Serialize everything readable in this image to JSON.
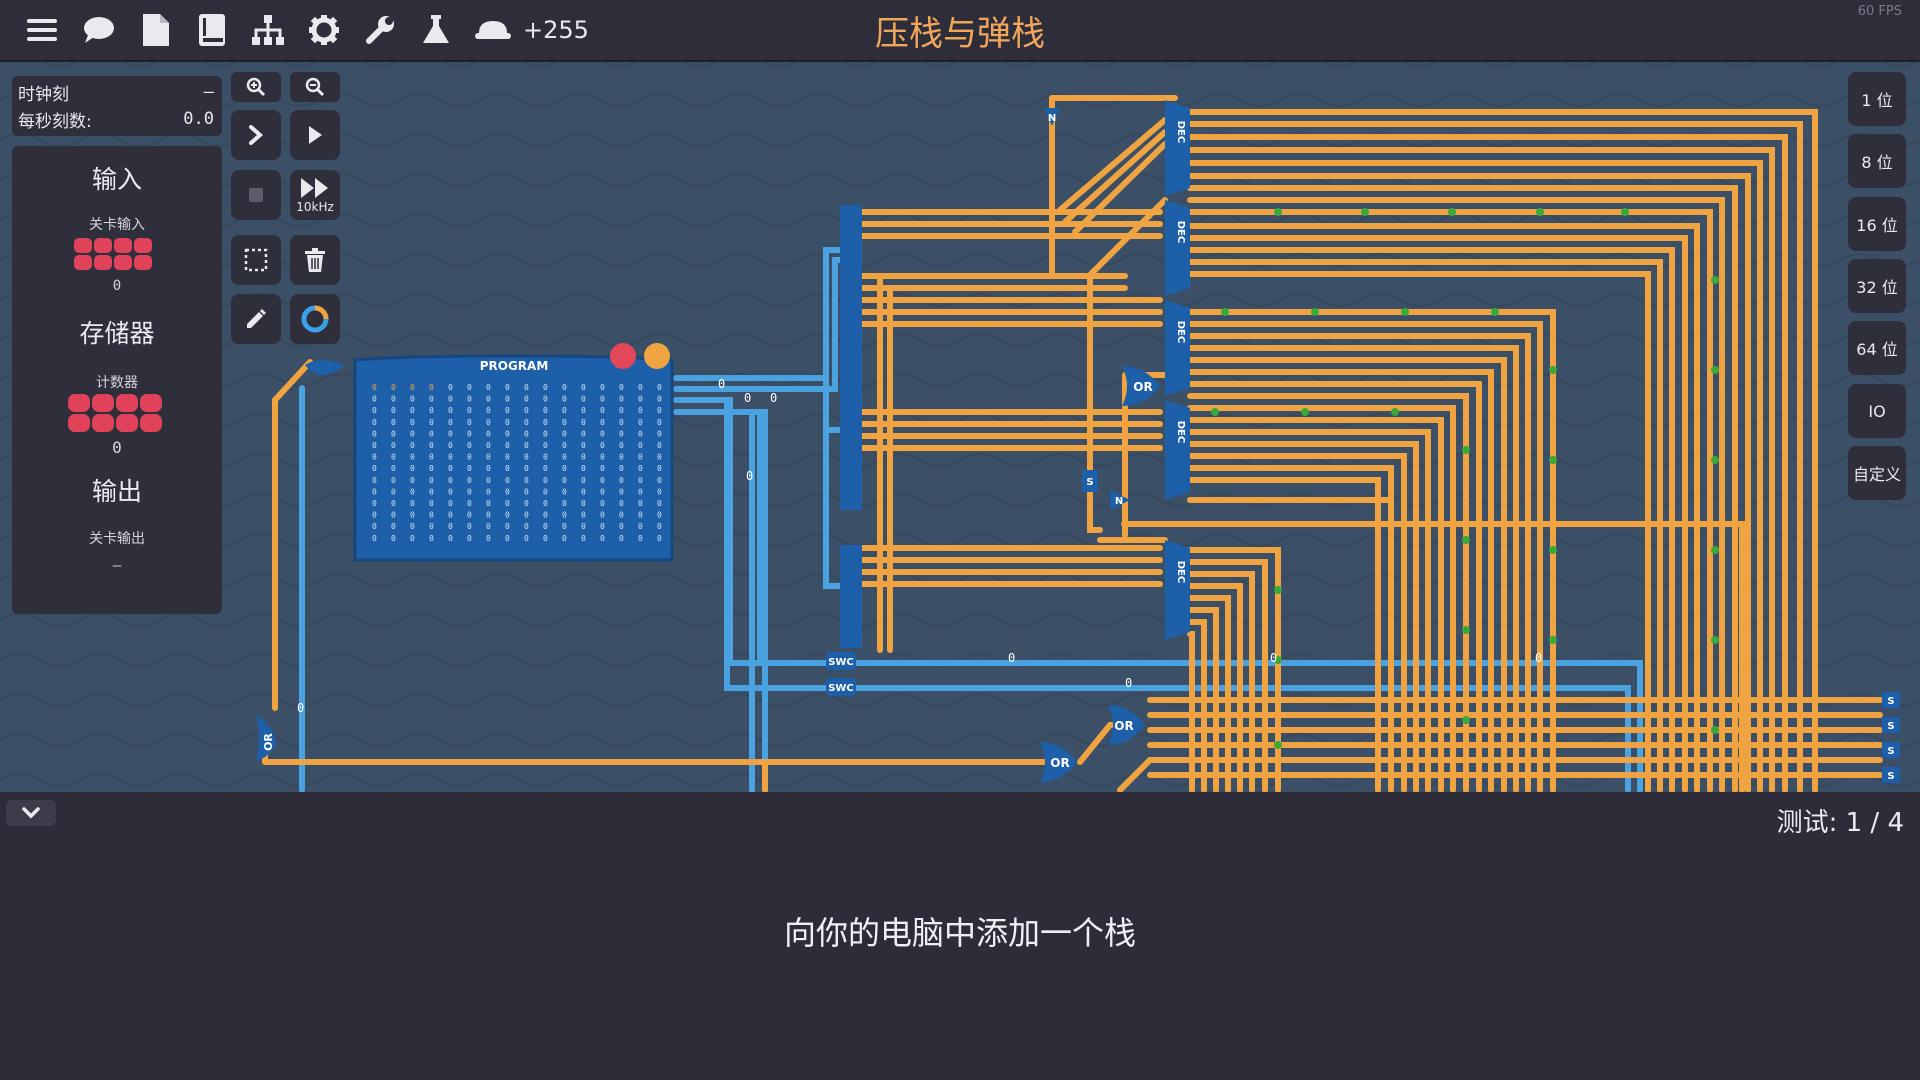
{
  "app": {
    "title": "压栈与弹栈",
    "coins": "+255",
    "fps": "60 FPS"
  },
  "topbar": {
    "icons": [
      "menu-icon",
      "chat-icon",
      "document-icon",
      "book-icon",
      "hierarchy-icon",
      "gear-icon",
      "wrench-icon",
      "flask-icon",
      "hat-icon"
    ]
  },
  "clock": {
    "tick_label": "时钟刻",
    "tick_value": "–",
    "rate_label": "每秒刻数:",
    "rate_value": "0.0"
  },
  "io": {
    "input_heading": "输入",
    "input_sub": "关卡输入",
    "input_value": "0",
    "memory_heading": "存储器",
    "memory_sub": "计数器",
    "memory_value": "0",
    "output_heading": "输出",
    "output_sub": "关卡输出",
    "output_value": "–"
  },
  "tools": {
    "fast_forward_label": "10kHz"
  },
  "bit_buttons": [
    "1 位",
    "8 位",
    "16 位",
    "32 位",
    "64 位",
    "IO",
    "自定义"
  ],
  "circuit": {
    "program_label": "PROGRAM",
    "components": [
      "DEC",
      "DEC",
      "DEC",
      "DEC",
      "DEC",
      "OR",
      "OR",
      "OR",
      "OR",
      "SWC",
      "SWC",
      "S",
      "N",
      "N"
    ],
    "wire_values": [
      "0",
      "0",
      "0",
      "0",
      "0",
      "0",
      "0",
      "0",
      "0"
    ]
  },
  "bottom": {
    "test_progress": "测试: 1 / 4",
    "description": "向你的电脑中添加一个栈"
  },
  "colors": {
    "accent": "#f2a65a",
    "wire_orange": "#f0a441",
    "wire_blue": "#4aa3e0",
    "component_blue": "#1d5fa8",
    "led_red": "#e0425a",
    "canvas_bg": "#3b4f66"
  }
}
